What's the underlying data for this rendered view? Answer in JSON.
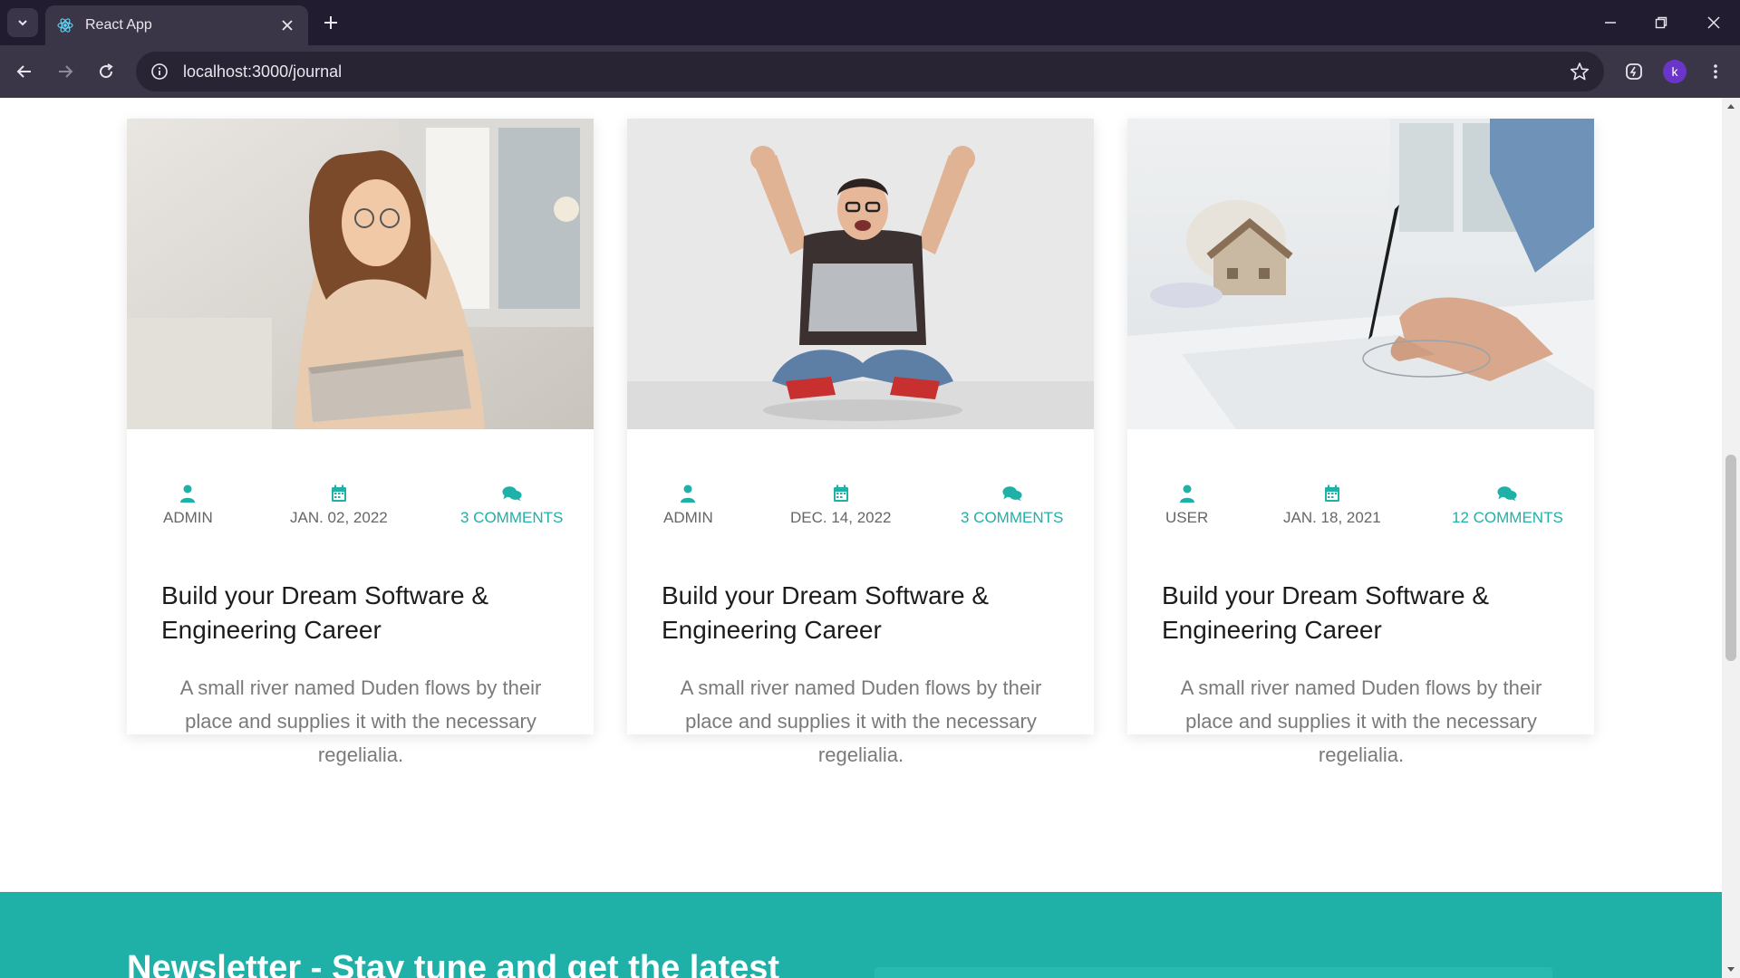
{
  "browser": {
    "tab_title": "React App",
    "url": "localhost:3000/journal",
    "profile_initial": "k"
  },
  "colors": {
    "accent": "#1fb0a7",
    "titlebar": "#211c2f",
    "toolbar": "#3b3647"
  },
  "posts": [
    {
      "author": "ADMIN",
      "date": "JAN. 02, 2022",
      "comments": "3 COMMENTS",
      "title": "Build your Dream Software & Engineering Career",
      "description": "A small river named Duden flows by their place and supplies it with the necessary regelialia.",
      "image_alt": "woman-with-laptop-photo"
    },
    {
      "author": "ADMIN",
      "date": "DEC. 14, 2022",
      "comments": "3 COMMENTS",
      "title": "Build your Dream Software & Engineering Career",
      "description": "A small river named Duden flows by their place and supplies it with the necessary regelialia.",
      "image_alt": "excited-man-with-laptop-photo"
    },
    {
      "author": "USER",
      "date": "JAN. 18, 2021",
      "comments": "12 COMMENTS",
      "title": "Build your Dream Software & Engineering Career",
      "description": "A small river named Duden flows by their place and supplies it with the necessary regelialia.",
      "image_alt": "architect-drawing-plans-photo"
    }
  ],
  "newsletter": {
    "heading": "Newsletter - Stay tune and get the latest"
  }
}
